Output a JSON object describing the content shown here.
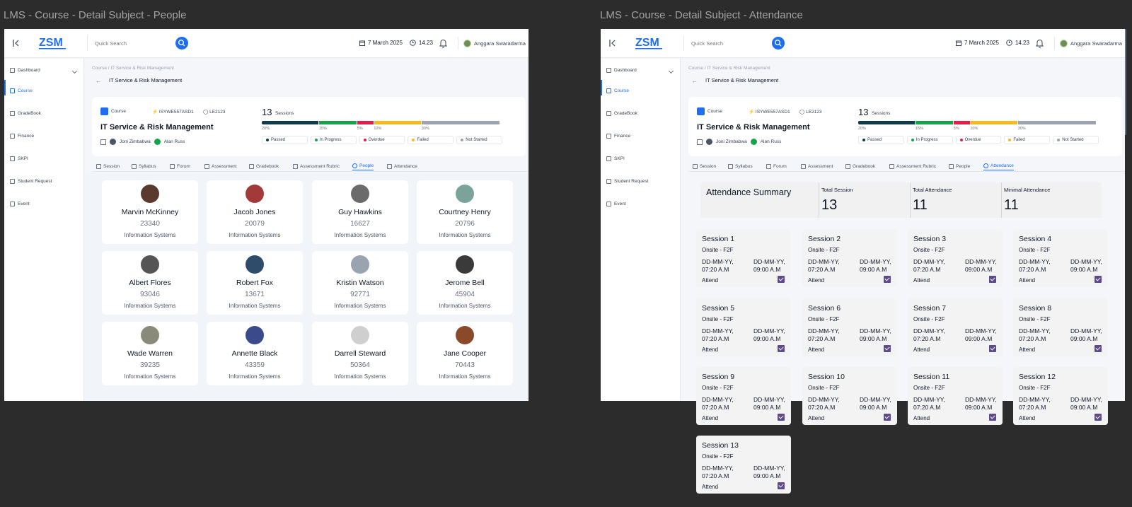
{
  "frames": [
    {
      "title": "LMS - Course - Detail Subject - People"
    },
    {
      "title": "LMS - Course - Detail Subject - Attendance"
    }
  ],
  "topbar": {
    "search_placeholder": "Quick Search",
    "date": "7 March 2025",
    "time": "14.23",
    "user_name": "Anggara Swaradarma",
    "logo_text": "ZSM"
  },
  "sidebar": {
    "items": [
      {
        "label": "Dashboard",
        "icon": "dashboard-icon"
      },
      {
        "label": "Course",
        "icon": "lightbulb-icon"
      },
      {
        "label": "GradeBook",
        "icon": "gradebook-icon"
      },
      {
        "label": "Finance",
        "icon": "finance-icon"
      },
      {
        "label": "SKPI",
        "icon": "list-icon"
      },
      {
        "label": "Student Request",
        "icon": "request-icon"
      },
      {
        "label": "Event",
        "icon": "calendar-icon"
      }
    ]
  },
  "page": {
    "breadcrumb": "Course / IT Service & Risk Management",
    "title": "IT Service & Risk Management"
  },
  "course": {
    "badge": "Course",
    "code1": "ISYWE557ASD1",
    "code2": "LE2123",
    "title": "IT Service & Risk Management",
    "lecturer1": "Joni Zimbabwa",
    "lecturer2": "Alan Russ",
    "sessions_count": "13",
    "sessions_label": "Sessions",
    "progress": [
      {
        "label": "Passed",
        "pct": "20%",
        "value": 24,
        "color": "#0f3b4a"
      },
      {
        "label": "In Progress",
        "pct": "15%",
        "value": 16,
        "color": "#16a34a"
      },
      {
        "label": "Overdue",
        "pct": "5%",
        "value": 7,
        "color": "#e11d48"
      },
      {
        "label": "Failed",
        "pct": "10%",
        "value": 20,
        "color": "#f5b921"
      },
      {
        "label": "Not Started",
        "pct": "30%",
        "value": 33,
        "color": "#9ca3af"
      }
    ]
  },
  "tabs": [
    {
      "label": "Session"
    },
    {
      "label": "Syllabus"
    },
    {
      "label": "Forum"
    },
    {
      "label": "Assessment"
    },
    {
      "label": "Gradebook"
    },
    {
      "label": "Assessment Rubric"
    },
    {
      "label": "People"
    },
    {
      "label": "Attendance"
    }
  ],
  "people": [
    {
      "name": "Marvin McKinney",
      "id": "23340",
      "dept": "Information Systems",
      "avatar_color": "#5b3a2e"
    },
    {
      "name": "Jacob Jones",
      "id": "20079",
      "dept": "Information Systems",
      "avatar_color": "#a33a3a"
    },
    {
      "name": "Guy Hawkins",
      "id": "16627",
      "dept": "Information Systems",
      "avatar_color": "#6b6b6b"
    },
    {
      "name": "Courtney Henry",
      "id": "20796",
      "dept": "Information Systems",
      "avatar_color": "#7aa39a"
    },
    {
      "name": "Albert Flores",
      "id": "93046",
      "dept": "Information Systems",
      "avatar_color": "#555555"
    },
    {
      "name": "Robert Fox",
      "id": "13671",
      "dept": "Information Systems",
      "avatar_color": "#2f4d6b"
    },
    {
      "name": "Kristin Watson",
      "id": "92771",
      "dept": "Information Systems",
      "avatar_color": "#9aa3b0"
    },
    {
      "name": "Jerome Bell",
      "id": "45904",
      "dept": "Information Systems",
      "avatar_color": "#3a3a3a"
    },
    {
      "name": "Wade Warren",
      "id": "39235",
      "dept": "Information Systems",
      "avatar_color": "#8a8a7a"
    },
    {
      "name": "Annette Black",
      "id": "43359",
      "dept": "Information Systems",
      "avatar_color": "#3b4a8a"
    },
    {
      "name": "Darrell Steward",
      "id": "50364",
      "dept": "Information Systems",
      "avatar_color": "#cfcfcf"
    },
    {
      "name": "Jane Cooper",
      "id": "70443",
      "dept": "Information Systems",
      "avatar_color": "#8a4a2a"
    }
  ],
  "attendance": {
    "title": "Attendance Summary",
    "total_session_label": "Total Session",
    "total_session": "13",
    "total_attendance_label": "Total Attendance",
    "total_attendance": "11",
    "minimal_attendance_label": "Minimal Attendance",
    "minimal_attendance": "11",
    "sessions": [
      {
        "name": "Session 1",
        "mode": "Onsite - F2F",
        "start": "DD-MM-YY,",
        "start_time": "07:20 A.M",
        "end": "DD-MM-YY,",
        "end_time": "09:00 A.M",
        "status": "Attend"
      },
      {
        "name": "Session 2",
        "mode": "Onsite - F2F",
        "start": "DD-MM-YY,",
        "start_time": "07:20 A.M",
        "end": "DD-MM-YY,",
        "end_time": "09:00 A.M",
        "status": "Attend"
      },
      {
        "name": "Session 3",
        "mode": "Onsite - F2F",
        "start": "DD-MM-YY,",
        "start_time": "07:20 A.M",
        "end": "DD-MM-YY,",
        "end_time": "09:00 A.M",
        "status": "Attend"
      },
      {
        "name": "Session 4",
        "mode": "Onsite - F2F",
        "start": "DD-MM-YY,",
        "start_time": "07:20 A.M",
        "end": "DD-MM-YY,",
        "end_time": "09:00 A.M",
        "status": "Attend"
      },
      {
        "name": "Session 5",
        "mode": "Onsite - F2F",
        "start": "DD-MM-YY,",
        "start_time": "07:20 A.M",
        "end": "DD-MM-YY,",
        "end_time": "09:00 A.M",
        "status": "Attend"
      },
      {
        "name": "Session 6",
        "mode": "Onsite - F2F",
        "start": "DD-MM-YY,",
        "start_time": "07:20 A.M",
        "end": "DD-MM-YY,",
        "end_time": "09:00 A.M",
        "status": "Attend"
      },
      {
        "name": "Session 7",
        "mode": "Onsite - F2F",
        "start": "DD-MM-YY,",
        "start_time": "07:20 A.M",
        "end": "DD-MM-YY,",
        "end_time": "09:00 A.M",
        "status": "Attend"
      },
      {
        "name": "Session 8",
        "mode": "Onsite - F2F",
        "start": "DD-MM-YY,",
        "start_time": "07:20 A.M",
        "end": "DD-MM-YY,",
        "end_time": "09:00 A.M",
        "status": "Attend"
      },
      {
        "name": "Session 9",
        "mode": "Onsite - F2F",
        "start": "DD-MM-YY,",
        "start_time": "07:20 A.M",
        "end": "DD-MM-YY,",
        "end_time": "09:00 A.M",
        "status": "Attend"
      },
      {
        "name": "Session 10",
        "mode": "Onsite - F2F",
        "start": "DD-MM-YY,",
        "start_time": "07:20 A.M",
        "end": "DD-MM-YY,",
        "end_time": "09:00 A.M",
        "status": "Attend"
      },
      {
        "name": "Session 11",
        "mode": "Onsite - F2F",
        "start": "DD-MM-YY,",
        "start_time": "07:20 A.M",
        "end": "DD-MM-YY,",
        "end_time": "09:00 A.M",
        "status": "Attend"
      },
      {
        "name": "Session 12",
        "mode": "Onsite - F2F",
        "start": "DD-MM-YY,",
        "start_time": "07:20 A.M",
        "end": "DD-MM-YY,",
        "end_time": "09:00 A.M",
        "status": "Attend"
      },
      {
        "name": "Session 13",
        "mode": "Onsite - F2F",
        "start": "DD-MM-YY,",
        "start_time": "07:20 A.M",
        "end": "DD-MM-YY,",
        "end_time": "09:00 A.M",
        "status": "Attend"
      }
    ]
  },
  "colors": {
    "accent": "#1d6ef0",
    "checkbox": "#5b4b8a",
    "canvas": "#2c2c2c"
  }
}
